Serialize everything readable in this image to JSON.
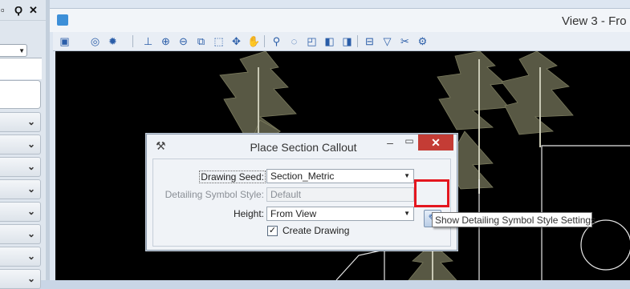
{
  "left_panel": {
    "title_icons": [
      "pin-icon",
      "auto-hide-icon",
      "close-icon"
    ],
    "title_glyphs": [
      "▫",
      "Ϙ",
      "✕"
    ],
    "combo_arrow": "▼",
    "row_chevron": "⌄",
    "rows": [
      "",
      "",
      "",
      "",
      "",
      "",
      "",
      ""
    ]
  },
  "view": {
    "title": "View 3 - Fro"
  },
  "toolbar": {
    "icons": [
      "view-attributes-icon",
      "display-style-icon",
      "lighting-icon",
      "measure-icon",
      "zoom-in-icon",
      "zoom-out-icon",
      "zoom-window-icon",
      "fit-view-icon",
      "rotate-view-icon",
      "pan-icon",
      "walk-icon",
      "look-icon",
      "camera-icon",
      "previous-view-icon",
      "next-view-icon",
      "clip-volume-icon",
      "clip-mask-icon",
      "section-icon",
      "view-settings-icon"
    ],
    "glyphs": [
      "▣",
      "◎",
      "✹",
      "⊥",
      "⊕",
      "⊖",
      "⧉",
      "⬚",
      "✥",
      "✋",
      "⚲",
      "◌",
      "◰",
      "◧",
      "◨",
      "⊟",
      "▽",
      "✂",
      "⚙"
    ]
  },
  "dialog": {
    "title": "Place Section Callout",
    "minimize": "–",
    "maximize": "▭",
    "close": "✕",
    "drawing_seed_label": "Drawing Seed:",
    "drawing_seed_value": "Section_Metric",
    "detailing_style_label": "Detailing Symbol Style:",
    "detailing_style_value": "Default",
    "height_label": "Height:",
    "height_value": "From View",
    "create_drawing_label": "Create Drawing",
    "create_drawing_checked": "✓",
    "combo_arrow": "▼",
    "style_button_glyph": "✎"
  },
  "tooltip": {
    "text": "Show Detailing Symbol Style Settings"
  },
  "colors": {
    "highlight": "#e4161f",
    "close_button": "#c43c35",
    "canvas": "#000000"
  }
}
